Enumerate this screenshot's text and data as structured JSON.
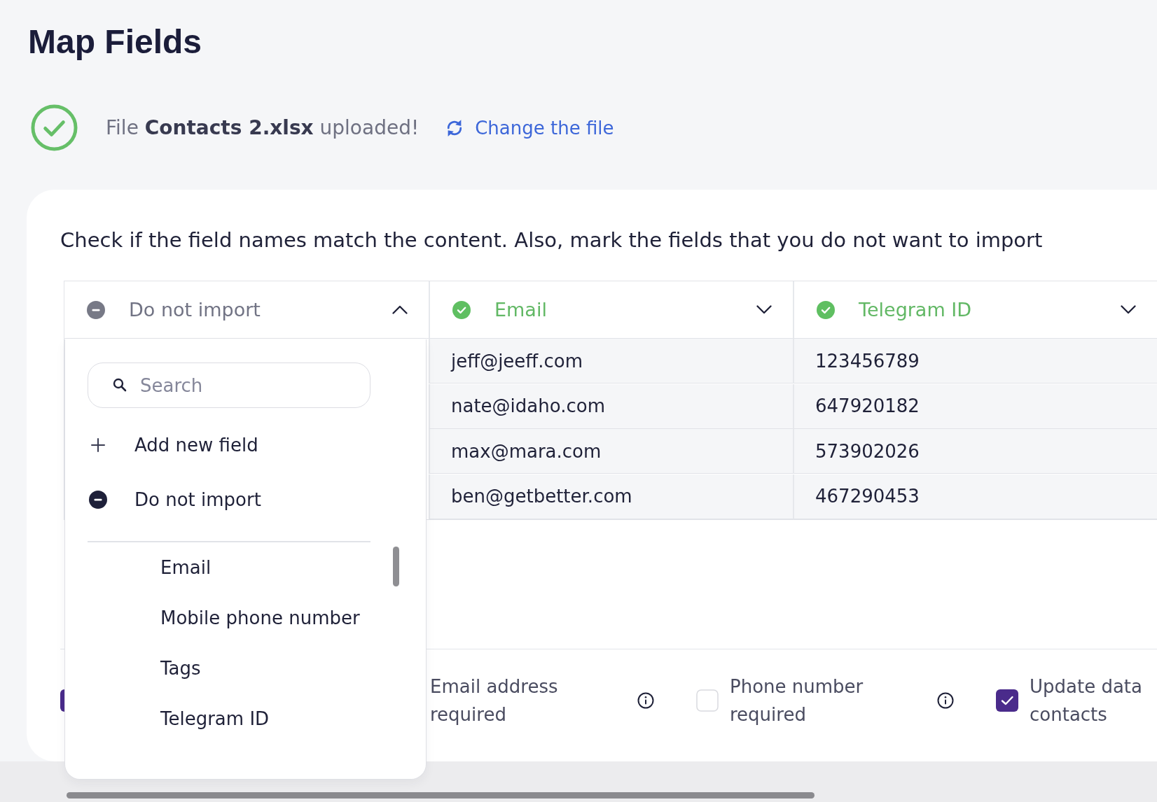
{
  "page_title": "Map Fields",
  "upload": {
    "message": "File **Contacts 2.xlsx** uploaded!",
    "change_link": "Change the file"
  },
  "instruction": "Check if the field names match the content. Also, mark the fields that you do not want to import",
  "columns": [
    {
      "header": "Do not import",
      "kind": "skip",
      "expanded": true
    },
    {
      "header": "Email",
      "kind": "matched",
      "expanded": false,
      "cells": [
        "jeff@jeeff.com",
        "nate@idaho.com",
        "max@mara.com",
        "ben@getbetter.com"
      ]
    },
    {
      "header": "Telegram ID",
      "kind": "matched",
      "expanded": false,
      "cells": [
        "123456789",
        "647920182",
        "573902026",
        "467290453"
      ]
    }
  ],
  "field_menu": {
    "search_placeholder": "Search",
    "actions": [
      {
        "kind": "add",
        "label": "Add new field"
      },
      {
        "kind": "skip",
        "label": "Do not import"
      }
    ],
    "fields": [
      "Email",
      "Mobile phone number",
      "Tags",
      "Telegram ID"
    ]
  },
  "options": [
    {
      "checked": true
    },
    {
      "label": "Email address\nrequired",
      "info": true
    },
    {
      "label": "Phone number\nrequired",
      "checked": false,
      "info": true
    },
    {
      "label": "Update data\ncontacts",
      "checked": true
    }
  ]
}
